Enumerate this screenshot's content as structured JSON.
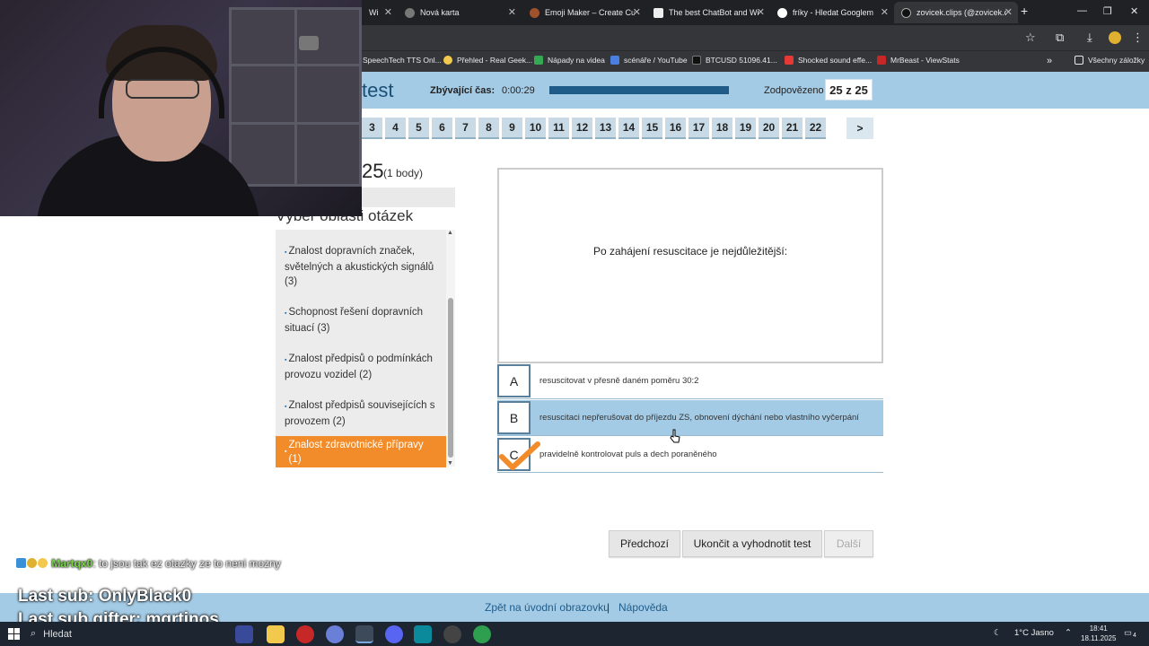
{
  "browser": {
    "tabs": [
      {
        "label": "Wi"
      },
      {
        "label": "Nová karta"
      },
      {
        "label": "Emoji Maker – Create Cus"
      },
      {
        "label": "The best ChatBot and Wr"
      },
      {
        "label": "fríky - Hledat Googlem"
      },
      {
        "label": "zovicek.clips (@zovicek.cl"
      }
    ],
    "new_tab": "+",
    "bookmarks": [
      {
        "label": "SpeechTech TTS Onl...",
        "color": "#3b6fd8"
      },
      {
        "label": "Přehled - Real Geek...",
        "color": "#f2c94c"
      },
      {
        "label": "Nápady na videa",
        "color": "#34a853"
      },
      {
        "label": "scénáře / YouTube",
        "color": "#4a7fe0"
      },
      {
        "label": "BTCUSD 51096.41...",
        "color": "#111111"
      },
      {
        "label": "Shocked sound effe...",
        "color": "#e53935"
      },
      {
        "label": "MrBeast - ViewStats",
        "color": "#c62828"
      }
    ],
    "bookmarks_all": "Všechny záložky"
  },
  "header": {
    "title": "test",
    "time_label": "Zbývající čas:",
    "time_value": "0:00:29",
    "progress": 1.0,
    "answered_label": "Zodpovězeno",
    "answered_value": "25 z 25"
  },
  "question_numbers": [
    "3",
    "4",
    "5",
    "6",
    "7",
    "8",
    "9",
    "10",
    "11",
    "12",
    "13",
    "14",
    "15",
    "16",
    "17",
    "18",
    "19",
    "20",
    "21",
    "22"
  ],
  "next_page": ">",
  "left_panel": {
    "question_number": "25",
    "points": "(1 body)",
    "area_title": "Výběr oblasti otázek",
    "areas": [
      {
        "label": "Znalost dopravních značek, světelných a akustických signálů (3)"
      },
      {
        "label": "Schopnost řešení dopravních situací (3)"
      },
      {
        "label": "Znalost předpisů o podmínkách provozu vozidel (2)"
      },
      {
        "label": "Znalost předpisů souvisejících s provozem (2)"
      },
      {
        "label": "Znalost zdravotnické přípravy (1)"
      }
    ],
    "active_area": 4
  },
  "question": {
    "text": "Po zahájení resuscitace je nejdůležitější:",
    "answers": [
      {
        "letter": "A",
        "text": "resuscitovat v přesně daném poměru 30:2"
      },
      {
        "letter": "B",
        "text": "resuscitaci nepřerušovat do příjezdu ZS, obnovení dýchání nebo vlastního vyčerpání"
      },
      {
        "letter": "C",
        "text": "pravidelně kontrolovat puls a dech poraněného"
      }
    ],
    "selected": "B"
  },
  "buttons": {
    "previous": "Předchozí",
    "finish": "Ukončit a vyhodnotit test",
    "next": "Další"
  },
  "footer": {
    "home": "Zpět na úvodní obrazovku",
    "separator": "|",
    "help": "Nápověda"
  },
  "overlay": {
    "chat_user": "Martqx0",
    "chat_message": ": to jsou tak ez otazky ze to neni mozny",
    "last_sub": "Last sub: OnlyBlack0",
    "last_sub_gifter": "Last sub gifter: mqrtinos"
  },
  "taskbar": {
    "search": "Hledat",
    "weather": "1°C  Jasno",
    "time": "18:41",
    "date": "18.11.2025",
    "notifications": "4"
  },
  "colors": {
    "header_bg": "#a4cbe5",
    "active_area": "#f28c2a",
    "selected_answer": "#a4cbe5",
    "check": "#f28c2a"
  }
}
